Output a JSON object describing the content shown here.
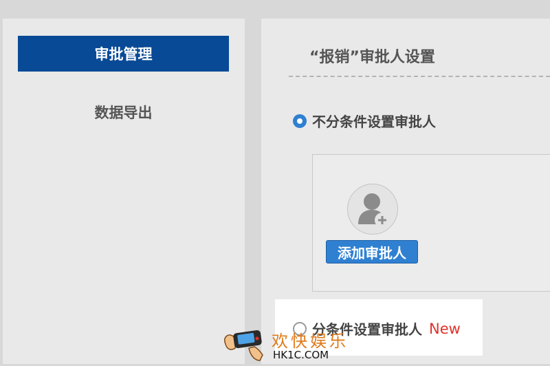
{
  "sidebar": {
    "items": [
      {
        "label": "审批管理",
        "active": true
      },
      {
        "label": "数据导出",
        "active": false
      }
    ]
  },
  "main": {
    "title": "“报销”审批人设置",
    "option_unconditional": "不分条件设置审批人",
    "add_approver_label": "添加审批人",
    "option_conditional": "分条件设置审批人",
    "new_badge": "New"
  },
  "watermark": {
    "title": "欢快娱乐",
    "url": "HK1C.COM"
  },
  "colors": {
    "nav_active": "#084a96",
    "accent_blue": "#2f80d1",
    "badge_red": "#e0312b",
    "watermark_orange": "#e07a1a"
  },
  "icons": {
    "avatar": "user-add-icon",
    "watermark": "gamepad-hand-icon"
  }
}
